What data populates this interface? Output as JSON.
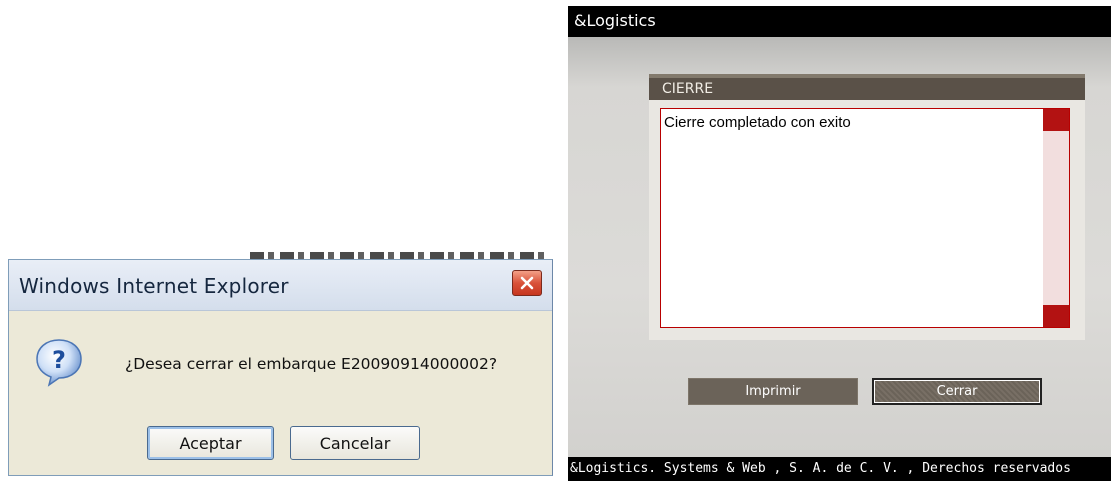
{
  "ie_dialog": {
    "title": "Windows Internet Explorer",
    "message": "¿Desea cerrar el embarque E20090914000002?",
    "accept_label": "Aceptar",
    "cancel_label": "Cancelar",
    "icons": {
      "close": "close-icon",
      "question": "question-icon"
    }
  },
  "logistics": {
    "brand": "&Logistics",
    "panel": {
      "title": "CIERRE",
      "message": "Cierre completado con exito"
    },
    "buttons": {
      "print_label": "Imprimir",
      "close_label": "Cerrar"
    },
    "footer": "&Logistics. Systems & Web , S. A. de C. V. , Derechos reservados"
  },
  "colors": {
    "ie_body": "#ece9d8",
    "logistics_panel_border": "#b80000",
    "logistics_button": "#6b6359",
    "logistics_header": "#000000"
  }
}
